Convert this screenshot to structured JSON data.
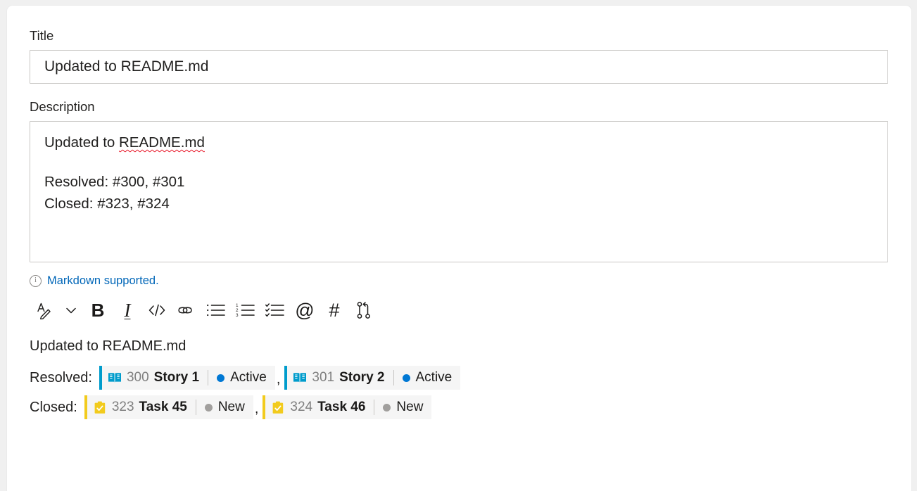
{
  "form": {
    "title_label": "Title",
    "title_value": "Updated to README.md",
    "title_placeholder": "Enter title",
    "description_label": "Description",
    "description_lines": [
      "Updated to README.md",
      "",
      "Resolved: #300, #301",
      "Closed: #323, #324"
    ],
    "description_first_plain": "Updated to ",
    "description_first_spellcheck": "README.md",
    "description_line_resolved": "Resolved: #300, #301",
    "description_line_closed": "Closed: #323, #324"
  },
  "hint": {
    "icon": "info-icon",
    "text": "Markdown supported."
  },
  "toolbar": {
    "items": [
      {
        "name": "text-style-icon",
        "label": "Text style"
      },
      {
        "name": "chevron-down-icon",
        "label": "More text styles"
      },
      {
        "name": "bold-icon",
        "label": "B"
      },
      {
        "name": "italic-icon",
        "label": "I"
      },
      {
        "name": "code-icon",
        "label": "</>"
      },
      {
        "name": "link-icon",
        "label": "Link"
      },
      {
        "name": "bulleted-list-icon",
        "label": "Bulleted list"
      },
      {
        "name": "numbered-list-icon",
        "label": "Numbered list"
      },
      {
        "name": "checklist-icon",
        "label": "Checklist"
      },
      {
        "name": "mention-icon",
        "label": "@"
      },
      {
        "name": "hashtag-icon",
        "label": "#"
      },
      {
        "name": "pull-request-icon",
        "label": "Link pull request"
      }
    ]
  },
  "preview": {
    "heading": "Updated to README.md",
    "rows": [
      {
        "label": "Resolved:",
        "separator": ",",
        "items": [
          {
            "id": "300",
            "title": "Story 1",
            "type": "User Story",
            "icon": "user-story-book-icon",
            "accent": "#009CCC",
            "state": "Active",
            "state_color": "#0078D4"
          },
          {
            "id": "301",
            "title": "Story 2",
            "type": "User Story",
            "icon": "user-story-book-icon",
            "accent": "#009CCC",
            "state": "Active",
            "state_color": "#0078D4"
          }
        ]
      },
      {
        "label": "Closed:",
        "separator": ",",
        "items": [
          {
            "id": "323",
            "title": "Task 45",
            "type": "Task",
            "icon": "task-clipboard-icon",
            "accent": "#F2CB1D",
            "state": "New",
            "state_color": "#A19F9D"
          },
          {
            "id": "324",
            "title": "Task 46",
            "type": "Task",
            "icon": "task-clipboard-icon",
            "accent": "#F2CB1D",
            "state": "New",
            "state_color": "#A19F9D"
          }
        ]
      }
    ]
  },
  "colors": {
    "panel": "#ffffff",
    "page_background": "#f0f0f0",
    "border": "#c8c6c4",
    "link": "#0066b8",
    "chip_background": "#f5f5f5",
    "text": "#201f1e",
    "muted_text": "#808080",
    "spellcheck_underline": "#e81123"
  }
}
